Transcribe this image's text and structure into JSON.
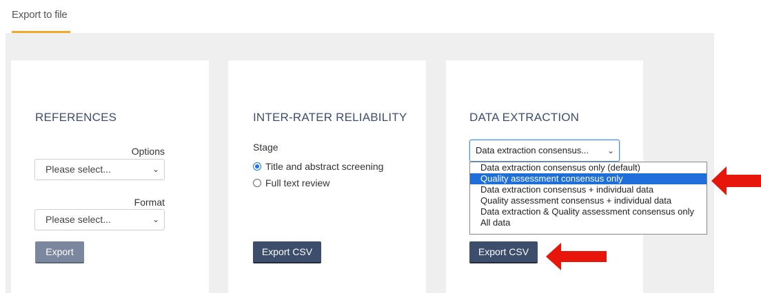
{
  "tab": {
    "label": "Export to file"
  },
  "references": {
    "title": "REFERENCES",
    "options_label": "Options",
    "options_value": "Please select...",
    "format_label": "Format",
    "format_value": "Please select...",
    "export_label": "Export"
  },
  "irr": {
    "title": "INTER-RATER RELIABILITY",
    "stage_label": "Stage",
    "stages": [
      {
        "label": "Title and abstract screening",
        "checked": true
      },
      {
        "label": "Full text review",
        "checked": false
      }
    ],
    "export_label": "Export CSV"
  },
  "data_extraction": {
    "title": "DATA EXTRACTION",
    "select_value": "Data extraction consensus...",
    "options": [
      "Data extraction consensus only (default)",
      "Quality assessment consensus only",
      "Data extraction consensus + individual data",
      "Quality assessment consensus + individual data",
      "Data extraction & Quality assessment consensus only",
      "All data"
    ],
    "highlighted_option": "Quality assessment consensus only",
    "export_label": "Export CSV"
  },
  "colors": {
    "accent": "#f5a623",
    "primary_button": "#3d4e6d",
    "highlight": "#1e6fd9",
    "annotation_arrow": "#e8150b"
  },
  "icons": {
    "chevron": "chevron-down-icon",
    "annotation": "red-arrow-icon"
  }
}
